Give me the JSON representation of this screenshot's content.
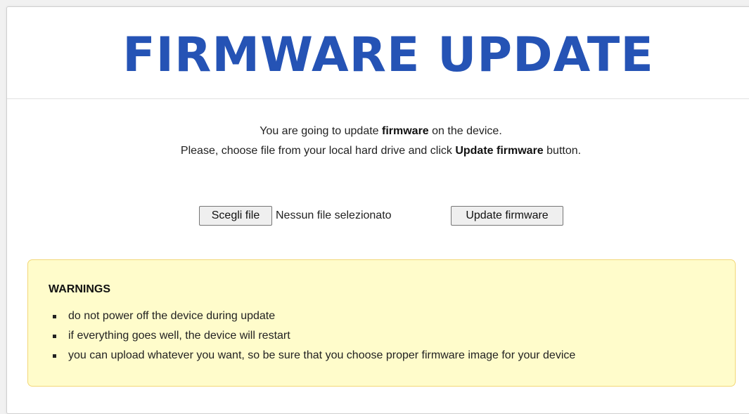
{
  "header": {
    "title": "FIRMWARE UPDATE"
  },
  "intro": {
    "line1_prefix": "You are going to update ",
    "line1_bold": "firmware",
    "line1_suffix": " on the device.",
    "line2_prefix": "Please, choose file from your local hard drive and click ",
    "line2_bold": "Update firmware",
    "line2_suffix": " button."
  },
  "form": {
    "choose_file_label": "Scegli file",
    "file_status": "Nessun file selezionato",
    "submit_label": "Update firmware"
  },
  "warnings": {
    "title": "WARNINGS",
    "items": [
      "do not power off the device during update",
      "if everything goes well, the device will restart",
      "you can upload whatever you want, so be sure that you choose proper firmware image for your device"
    ]
  },
  "colors": {
    "title": "#2553b5",
    "warning_bg": "#fffccb",
    "warning_border": "#f3d777"
  }
}
